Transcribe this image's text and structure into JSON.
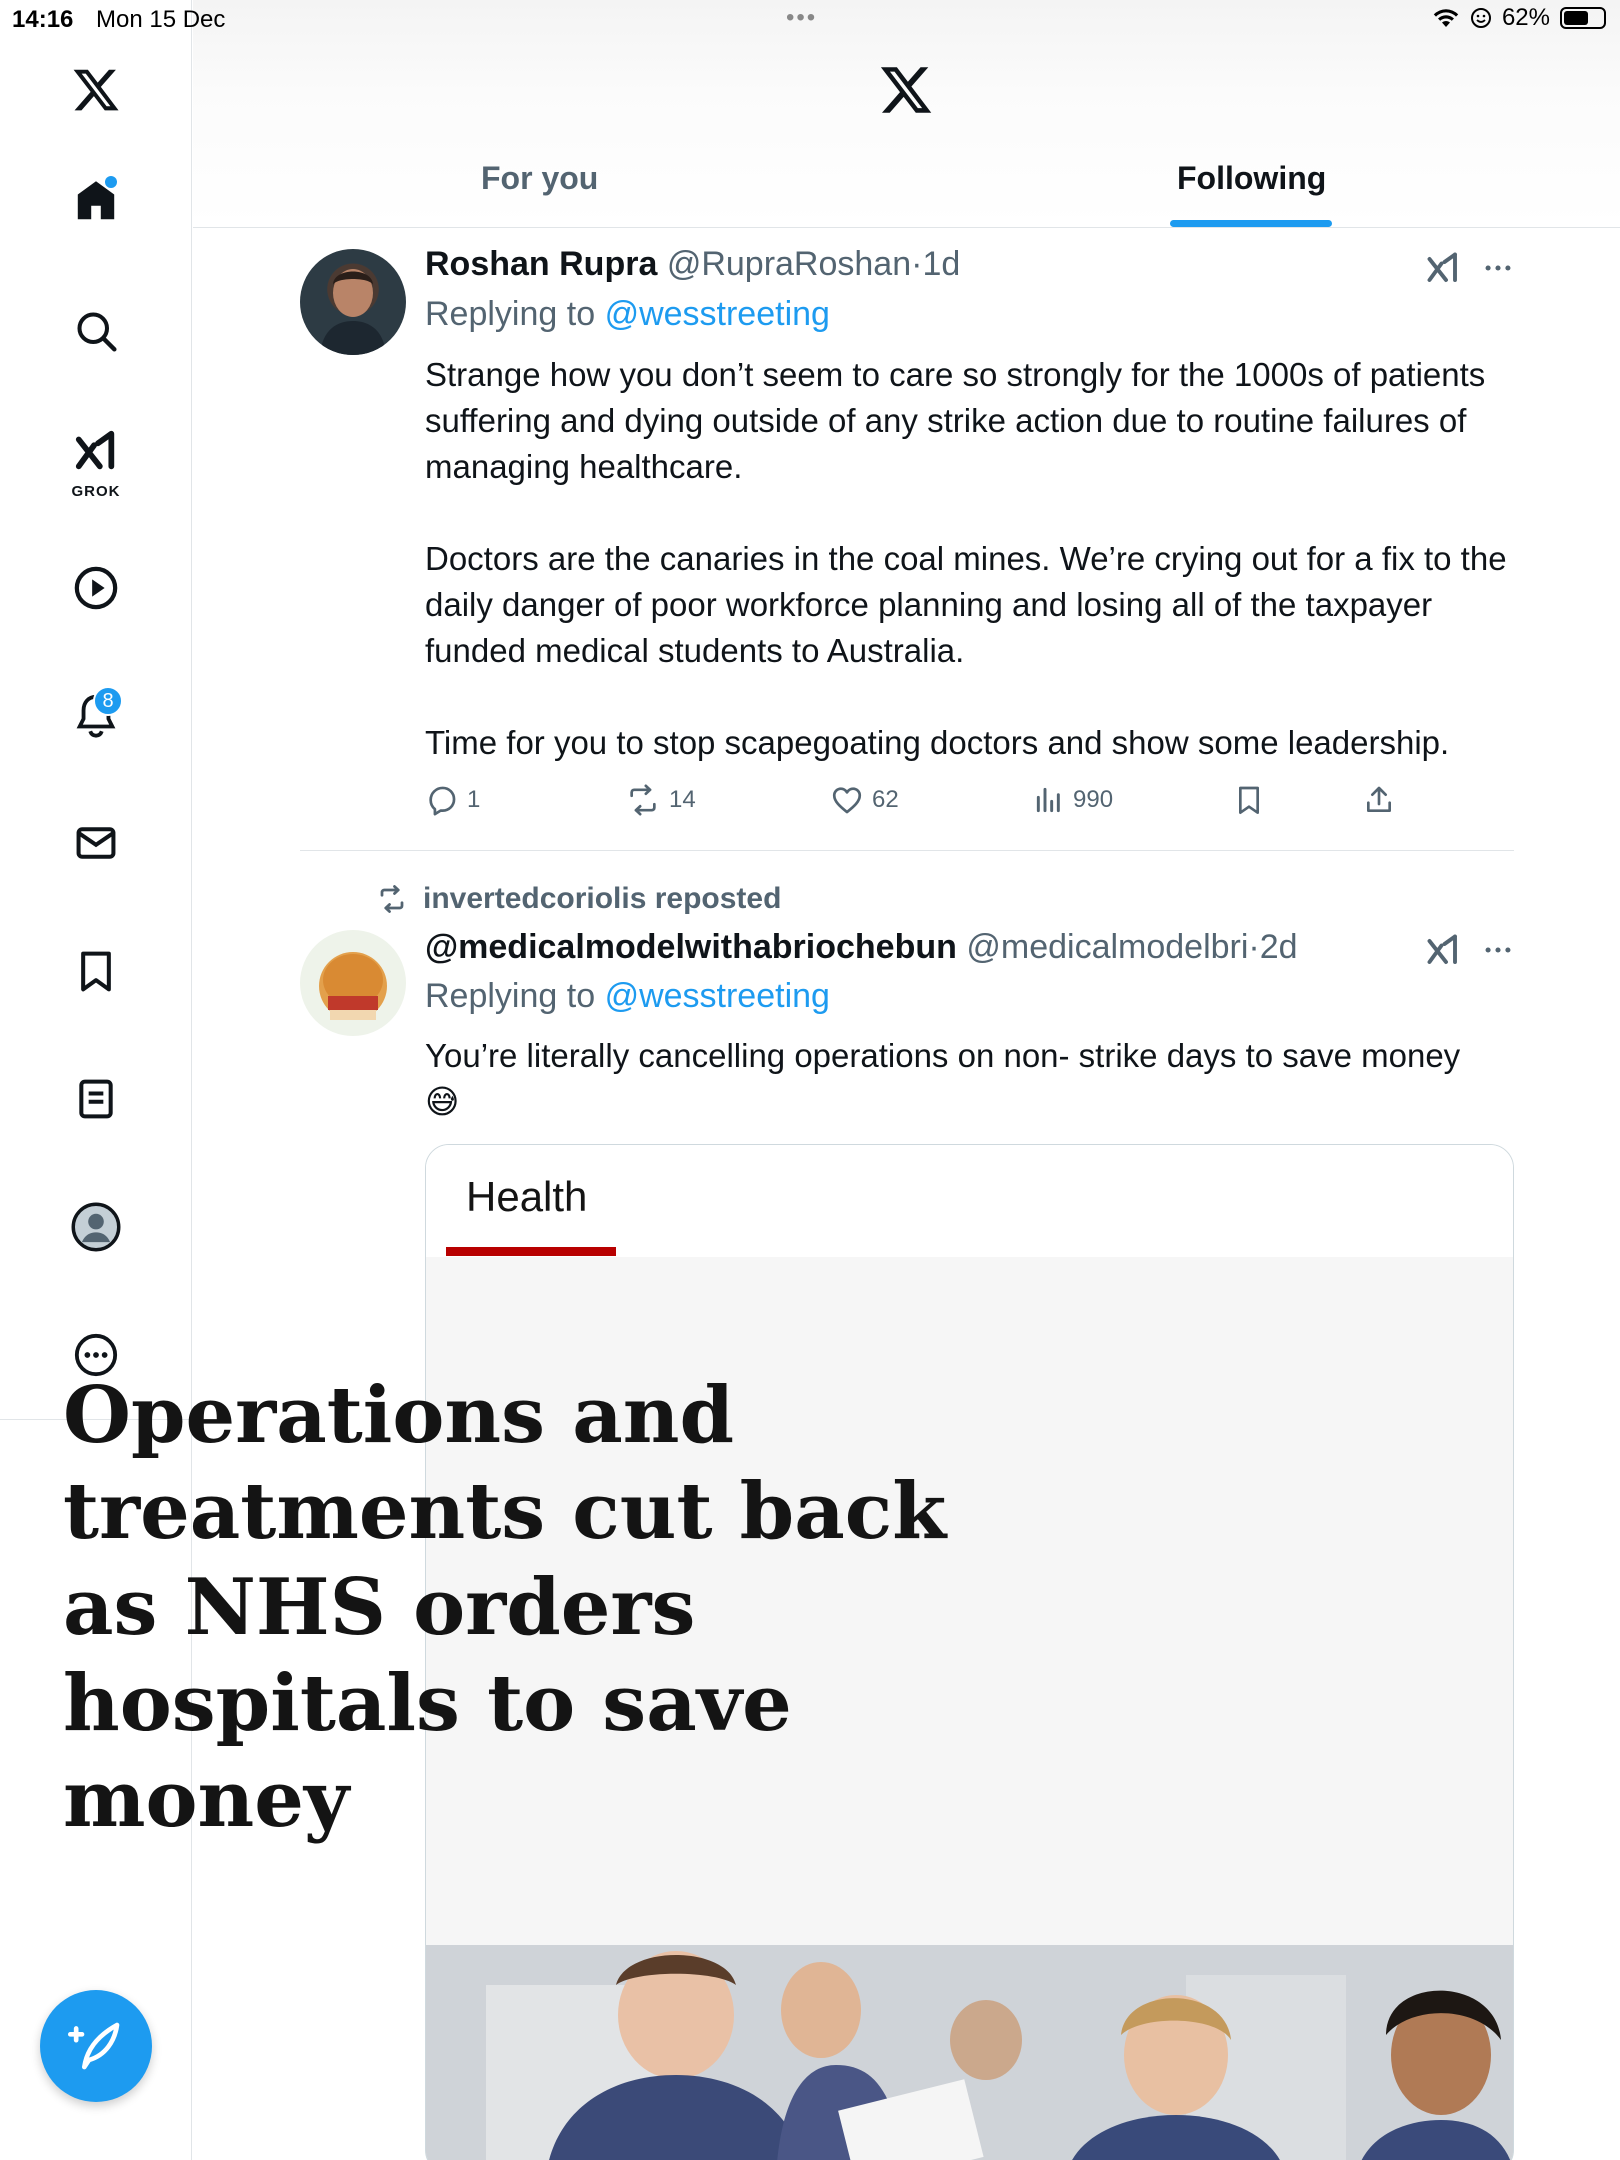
{
  "status": {
    "time": "14:16",
    "date": "Mon 15 Dec",
    "battery": "62%",
    "battery_level": 0.62
  },
  "sidebar": {
    "items": [
      {
        "icon": "x-logo-icon"
      },
      {
        "icon": "home-icon"
      },
      {
        "icon": "search-icon"
      },
      {
        "icon": "grok-icon",
        "label": "GROK"
      },
      {
        "icon": "video-play-icon"
      },
      {
        "icon": "notifications-bell-icon",
        "badge": "8"
      },
      {
        "icon": "messages-envelope-icon"
      },
      {
        "icon": "bookmark-icon"
      },
      {
        "icon": "lists-icon"
      },
      {
        "icon": "profile-icon"
      },
      {
        "icon": "more-icon"
      }
    ],
    "compose_icon": "compose-post-icon"
  },
  "header": {
    "logo_icon": "x-logo-icon",
    "tabs": [
      {
        "label": "For you",
        "active": false
      },
      {
        "label": "Following",
        "active": true
      }
    ]
  },
  "colors": {
    "accent": "#1d9bf0",
    "text": "#0f1419",
    "secondary": "#536471",
    "bbc_red": "#b80000"
  },
  "tweets": [
    {
      "name": "Roshan Rupra",
      "handle": "@RupraRoshan",
      "time": "1d",
      "replying_to_label": "Replying to",
      "replying_to": "@wesstreeting",
      "body": "Strange how you don’t seem to care so strongly for the 1000s of patients suffering and dying outside of any strike action due to routine failures of managing healthcare.\n\nDoctors are the canaries in the coal mines. We’re crying out for a fix to the daily danger of poor workforce planning and losing all of the taxpayer funded medical students to Australia.\n\nTime for you to stop scapegoating doctors and show some leadership.",
      "replies": "1",
      "reposts": "14",
      "likes": "62",
      "views": "990"
    },
    {
      "repost_by": "invertedcoriolis reposted",
      "name": "@medicalmodelwithabriochebun",
      "handle": "@medicalmodelbri",
      "time": "2d",
      "replying_to_label": "Replying to",
      "replying_to": "@wesstreeting",
      "body": "You’re literally cancelling operations on non- strike days to save money",
      "emoji": "😅",
      "card": {
        "section": "Health",
        "headline": "Operations and treatments cut back as NHS orders hospitals to save money"
      }
    }
  ]
}
